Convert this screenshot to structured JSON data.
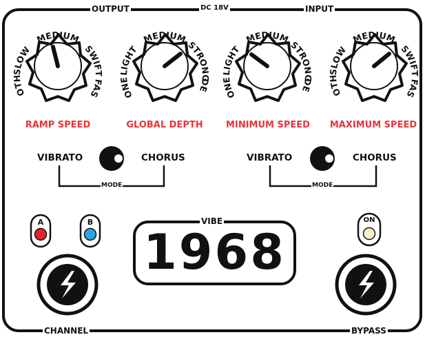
{
  "top_labels": {
    "output": "OUTPUT",
    "power": "DC 18V",
    "input": "INPUT"
  },
  "bottom_labels": {
    "channel": "CHANNEL",
    "bypass": "BYPASS"
  },
  "knobs": [
    {
      "name": "RAMP SPEED",
      "ticks": [
        "SLOTH",
        "SLOW",
        "MEDIUM",
        "SWIFT",
        "FAST"
      ]
    },
    {
      "name": "GLOBAL DEPTH",
      "ticks": [
        "NONE",
        "LIGHT",
        "MEDIUM",
        "STRONG",
        "DEEP"
      ]
    },
    {
      "name": "MINIMUM SPEED",
      "ticks": [
        "NONE",
        "LIGHT",
        "MEDIUM",
        "STRONG",
        "DEEP"
      ]
    },
    {
      "name": "MAXIMUM SPEED",
      "ticks": [
        "SLOTH",
        "SLOW",
        "MEDIUM",
        "SWIFT",
        "FAST"
      ]
    }
  ],
  "switches": [
    {
      "left": "VIBRATO",
      "right": "CHORUS",
      "group": "MODE"
    },
    {
      "left": "VIBRATO",
      "right": "CHORUS",
      "group": "MODE"
    }
  ],
  "leds": [
    {
      "label": "A",
      "color": "#e0242b"
    },
    {
      "label": "B",
      "color": "#2aa6e0"
    },
    {
      "label": "ON",
      "color": "#fbf3cf"
    }
  ],
  "display": {
    "title": "VIBE",
    "value": "1968"
  },
  "colors": {
    "accent": "#e8343a",
    "ink": "#111111"
  }
}
